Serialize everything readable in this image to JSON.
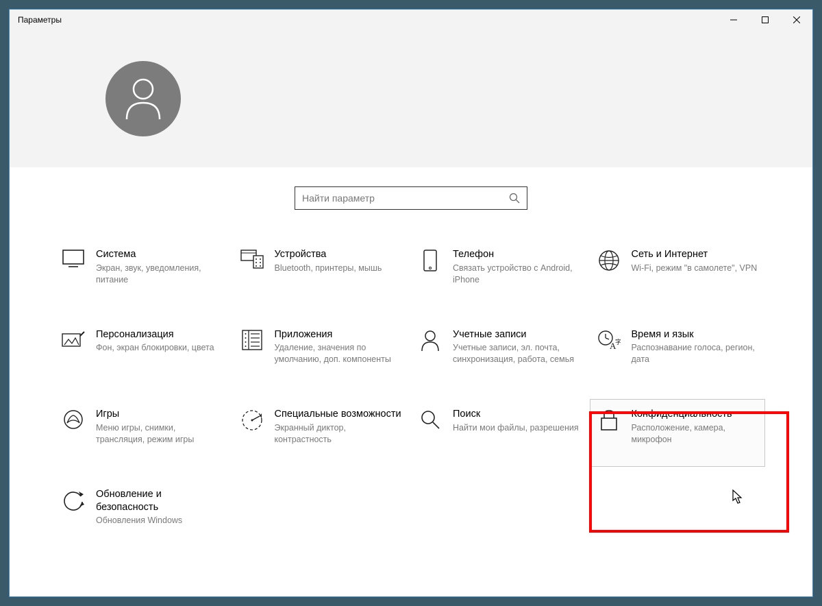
{
  "window": {
    "title": "Параметры"
  },
  "search": {
    "placeholder": "Найти параметр"
  },
  "tiles": {
    "system": {
      "name": "Система",
      "desc": "Экран, звук, уведомления, питание"
    },
    "devices": {
      "name": "Устройства",
      "desc": "Bluetooth, принтеры, мышь"
    },
    "phone": {
      "name": "Телефон",
      "desc": "Связать устройство с Android, iPhone"
    },
    "network": {
      "name": "Сеть и Интернет",
      "desc": "Wi-Fi, режим \"в самолете\", VPN"
    },
    "personalization": {
      "name": "Персонализация",
      "desc": "Фон, экран блокировки, цвета"
    },
    "apps": {
      "name": "Приложения",
      "desc": "Удаление, значения по умолчанию, доп. компоненты"
    },
    "accounts": {
      "name": "Учетные записи",
      "desc": "Учетные записи, эл. почта, синхронизация, работа, семья"
    },
    "time": {
      "name": "Время и язык",
      "desc": "Распознавание голоса, регион, дата"
    },
    "gaming": {
      "name": "Игры",
      "desc": "Меню игры, снимки, трансляция, режим игры"
    },
    "accessibility": {
      "name": "Специальные возможности",
      "desc": "Экранный диктор, контрастность"
    },
    "search_tile": {
      "name": "Поиск",
      "desc": "Найти мои файлы, разрешения"
    },
    "privacy": {
      "name": "Конфиденциальность",
      "desc": "Расположение, камера, микрофон"
    },
    "update": {
      "name": "Обновление и безопасность",
      "desc": "Обновления Windows"
    }
  }
}
